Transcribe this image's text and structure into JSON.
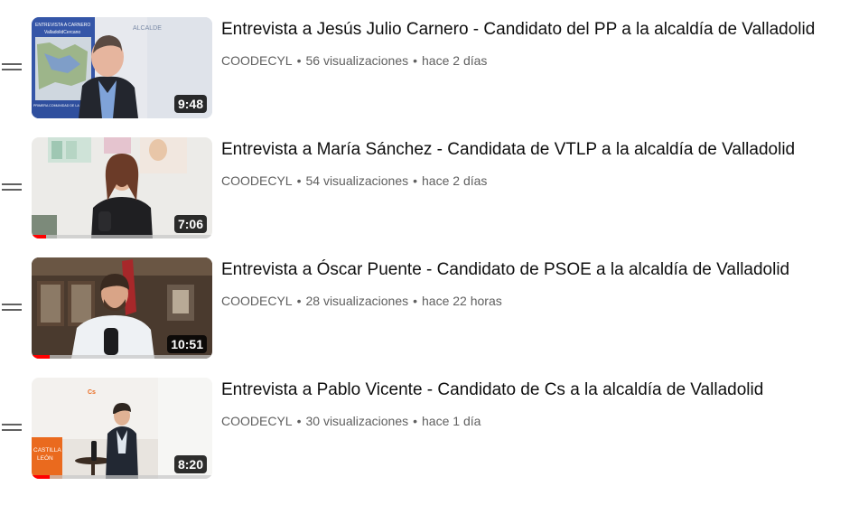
{
  "accent": "#ff0000",
  "drag_icon": "drag-handle-icon",
  "videos": [
    {
      "title": "Entrevista a Jesús Julio Carnero - Candidato del PP a la alcaldía de Valladolid",
      "channel": "COODECYL",
      "views": "56 visualizaciones",
      "age": "hace 2 días",
      "duration": "9:48",
      "progress": 0.0
    },
    {
      "title": "Entrevista a María Sánchez - Candidata de VTLP a la alcaldía de Valladolid",
      "channel": "COODECYL",
      "views": "54 visualizaciones",
      "age": "hace 2 días",
      "duration": "7:06",
      "progress": 0.08
    },
    {
      "title": "Entrevista a Óscar Puente - Candidato de PSOE a la alcaldía de Valladolid",
      "channel": "COODECYL",
      "views": "28 visualizaciones",
      "age": "hace 22 horas",
      "duration": "10:51",
      "progress": 0.1
    },
    {
      "title": "Entrevista a Pablo Vicente - Candidato de Cs a la alcaldía de Valladolid",
      "channel": "COODECYL",
      "views": "30 visualizaciones",
      "age": "hace 1 día",
      "duration": "8:20",
      "progress": 0.1
    }
  ],
  "thumbnail_texts": {
    "pp_board_line1": "ENTREVISTA A CARNERO",
    "pp_board_line2": "ALCALDE",
    "pp_board_map_title": "ValladolidCercano",
    "pp_board_bottom": "PRIMERA COMUNIDAD DE LA ENSEÑANZA POLÍTICA",
    "cs_logo": "Cs",
    "cs_wall_line1": "CASTILLA",
    "cs_wall_line2": "LEÓN"
  }
}
